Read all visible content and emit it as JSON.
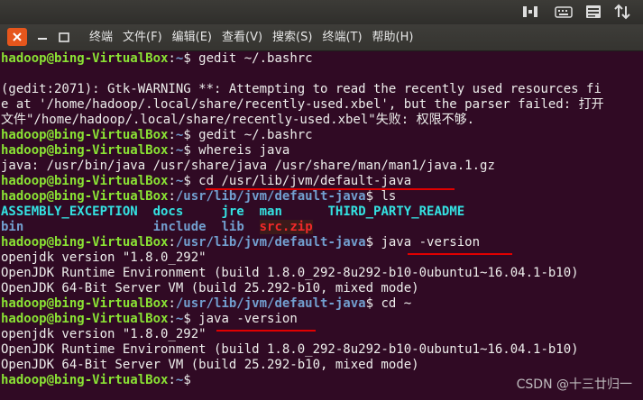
{
  "menubar": {
    "items": [
      "终端",
      "文件(F)",
      "编辑(E)",
      "查看(V)",
      "搜索(S)",
      "终端(T)",
      "帮助(H)"
    ]
  },
  "terminal": {
    "lines": [
      [
        {
          "t": "hadoop@bing-VirtualBox",
          "c": "u"
        },
        {
          "t": ":",
          "c": "w"
        },
        {
          "t": "~",
          "c": "p"
        },
        {
          "t": "$ gedit ~/.bashrc",
          "c": "w"
        }
      ],
      [
        {
          "t": "",
          "c": "w"
        }
      ],
      [
        {
          "t": "(gedit:2071): Gtk-WARNING **: Attempting to read the recently used resources fi",
          "c": "w"
        }
      ],
      [
        {
          "t": "e at '/home/hadoop/.local/share/recently-used.xbel', but the parser failed: 打开",
          "c": "w"
        }
      ],
      [
        {
          "t": "文件\"/home/hadoop/.local/share/recently-used.xbel\"失败: 权限不够.",
          "c": "w"
        }
      ],
      [
        {
          "t": "hadoop@bing-VirtualBox",
          "c": "u"
        },
        {
          "t": ":",
          "c": "w"
        },
        {
          "t": "~",
          "c": "p"
        },
        {
          "t": "$ gedit ~/.bashrc",
          "c": "w"
        }
      ],
      [
        {
          "t": "hadoop@bing-VirtualBox",
          "c": "u"
        },
        {
          "t": ":",
          "c": "w"
        },
        {
          "t": "~",
          "c": "p"
        },
        {
          "t": "$ whereis java",
          "c": "w"
        }
      ],
      [
        {
          "t": "java: /usr/bin/java /usr/share/java /usr/share/man/man1/java.1.gz",
          "c": "w"
        }
      ],
      [
        {
          "t": "hadoop@bing-VirtualBox",
          "c": "u"
        },
        {
          "t": ":",
          "c": "w"
        },
        {
          "t": "~",
          "c": "p"
        },
        {
          "t": "$ cd /usr/lib/jvm/default-java",
          "c": "w"
        }
      ],
      [
        {
          "t": "hadoop@bing-VirtualBox",
          "c": "u"
        },
        {
          "t": ":",
          "c": "w"
        },
        {
          "t": "/usr/lib/jvm/default-java",
          "c": "p"
        },
        {
          "t": "$ ls",
          "c": "w"
        }
      ],
      [
        {
          "t": "ASSEMBLY_EXCEPTION",
          "c": "d"
        },
        {
          "t": "  ",
          "c": "w"
        },
        {
          "t": "docs",
          "c": "d"
        },
        {
          "t": "     ",
          "c": "w"
        },
        {
          "t": "jre",
          "c": "d"
        },
        {
          "t": "  ",
          "c": "w"
        },
        {
          "t": "man",
          "c": "d"
        },
        {
          "t": "      ",
          "c": "w"
        },
        {
          "t": "THIRD_PARTY_README",
          "c": "d"
        }
      ],
      [
        {
          "t": "bin",
          "c": "b"
        },
        {
          "t": "                 ",
          "c": "w"
        },
        {
          "t": "include",
          "c": "b"
        },
        {
          "t": "  ",
          "c": "w"
        },
        {
          "t": "lib",
          "c": "b"
        },
        {
          "t": "  ",
          "c": "w"
        },
        {
          "t": "src.zip",
          "c": "z"
        }
      ],
      [
        {
          "t": "hadoop@bing-VirtualBox",
          "c": "u"
        },
        {
          "t": ":",
          "c": "w"
        },
        {
          "t": "/usr/lib/jvm/default-java",
          "c": "p"
        },
        {
          "t": "$ java -version",
          "c": "w"
        }
      ],
      [
        {
          "t": "openjdk version \"1.8.0_292\"",
          "c": "w"
        }
      ],
      [
        {
          "t": "OpenJDK Runtime Environment (build 1.8.0_292-8u292-b10-0ubuntu1~16.04.1-b10)",
          "c": "w"
        }
      ],
      [
        {
          "t": "OpenJDK 64-Bit Server VM (build 25.292-b10, mixed mode)",
          "c": "w"
        }
      ],
      [
        {
          "t": "hadoop@bing-VirtualBox",
          "c": "u"
        },
        {
          "t": ":",
          "c": "w"
        },
        {
          "t": "/usr/lib/jvm/default-java",
          "c": "p"
        },
        {
          "t": "$ cd ~",
          "c": "w"
        }
      ],
      [
        {
          "t": "hadoop@bing-VirtualBox",
          "c": "u"
        },
        {
          "t": ":",
          "c": "w"
        },
        {
          "t": "~",
          "c": "p"
        },
        {
          "t": "$ java -version",
          "c": "w"
        }
      ],
      [
        {
          "t": "openjdk version \"1.8.0_292\"",
          "c": "w"
        }
      ],
      [
        {
          "t": "OpenJDK Runtime Environment (build 1.8.0_292-8u292-b10-0ubuntu1~16.04.1-b10)",
          "c": "w"
        }
      ],
      [
        {
          "t": "OpenJDK 64-Bit Server VM (build 25.292-b10, mixed mode)",
          "c": "w"
        }
      ],
      [
        {
          "t": "hadoop@bing-VirtualBox",
          "c": "u"
        },
        {
          "t": ":",
          "c": "w"
        },
        {
          "t": "~",
          "c": "p"
        },
        {
          "t": "$ ",
          "c": "w"
        }
      ]
    ]
  },
  "watermark": "CSDN @十三廿归一",
  "colors": {
    "background": "#300a24",
    "user_host": "#8ae234",
    "path": "#729fcf",
    "directory": "#34e2e2",
    "archive": "#ef2929",
    "annotation_underline": "#e00000"
  }
}
